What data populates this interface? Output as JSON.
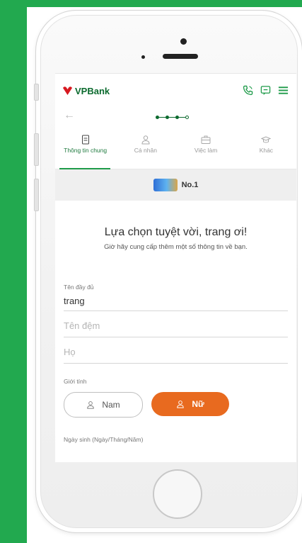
{
  "brand": {
    "name": "VPBank"
  },
  "header": {
    "icons": [
      "phone-icon",
      "chat-icon",
      "menu-icon"
    ],
    "accent_color": "#1f9b4a"
  },
  "progress": {
    "current_step": 3,
    "total_steps": 4
  },
  "tabs": [
    {
      "label": "Thông tin chung",
      "icon": "document-icon",
      "active": true
    },
    {
      "label": "Cá nhân",
      "icon": "person-icon",
      "active": false
    },
    {
      "label": "Việc làm",
      "icon": "briefcase-icon",
      "active": false
    },
    {
      "label": "Khác",
      "icon": "graduation-cap-icon",
      "active": false
    }
  ],
  "promo": {
    "text": "No.1",
    "color_primary": "#2f6fd6"
  },
  "greeting": {
    "title": "Lựa chọn tuyệt vời, trang ơi!",
    "subtitle": "Giờ hãy cung cấp thêm một số thông tin về bạn."
  },
  "form": {
    "full_name_label": "Tên đầy đủ",
    "full_name_value": "trang",
    "middle_name_placeholder": "Tên đệm",
    "last_name_placeholder": "Họ",
    "gender_label": "Giới tính",
    "gender_male": "Nam",
    "gender_female": "Nữ",
    "gender_selected": "Nữ",
    "dob_label": "Ngày sinh (Ngày/Tháng/Năm)"
  },
  "colors": {
    "background_green": "#22a94f",
    "selected_orange": "#e86a1f",
    "brand_red": "#d71920"
  }
}
